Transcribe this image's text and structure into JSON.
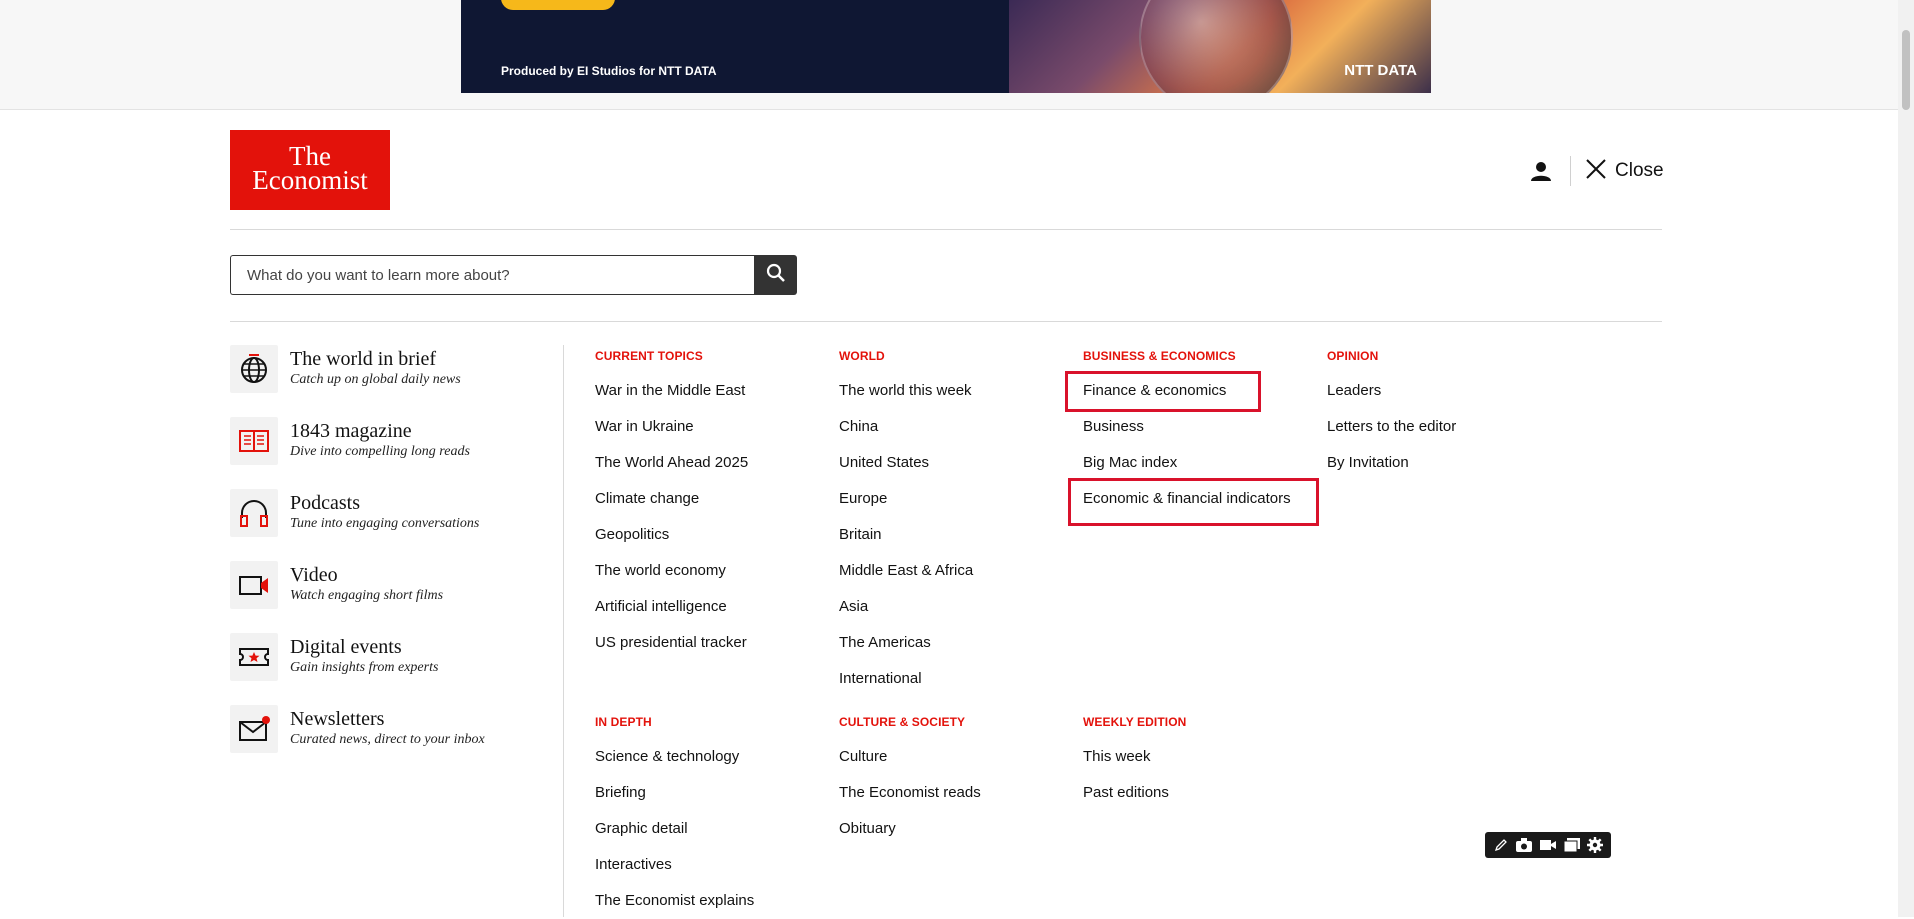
{
  "ad": {
    "credit": "Produced by EI Studios for NTT DATA",
    "brand": "NTT DATA"
  },
  "header": {
    "logo_line1": "The",
    "logo_line2": "Economist",
    "close_label": "Close"
  },
  "search": {
    "placeholder": "What do you want to learn more about?"
  },
  "products": [
    {
      "title": "The world in brief",
      "subtitle": "Catch up on global daily news",
      "icon": "globe-icon"
    },
    {
      "title": "1843 magazine",
      "subtitle": "Dive into compelling long reads",
      "icon": "magazine-icon"
    },
    {
      "title": "Podcasts",
      "subtitle": "Tune into engaging conversations",
      "icon": "headphones-icon"
    },
    {
      "title": "Video",
      "subtitle": "Watch engaging short films",
      "icon": "video-camera-icon"
    },
    {
      "title": "Digital events",
      "subtitle": "Gain insights from experts",
      "icon": "ticket-icon"
    },
    {
      "title": "Newsletters",
      "subtitle": "Curated news, direct to your inbox",
      "icon": "mail-icon"
    }
  ],
  "nav": {
    "current_topics": {
      "heading": "Current topics",
      "items": [
        "War in the Middle East",
        "War in Ukraine",
        "The World Ahead 2025",
        "Climate change",
        "Geopolitics",
        "The world economy",
        "Artificial intelligence",
        "US presidential tracker"
      ]
    },
    "world": {
      "heading": "World",
      "items": [
        "The world this week",
        "China",
        "United States",
        "Europe",
        "Britain",
        "Middle East & Africa",
        "Asia",
        "The Americas",
        "International"
      ]
    },
    "business": {
      "heading": "Business & economics",
      "items": [
        "Finance & economics",
        "Business",
        "Big Mac index",
        "Economic & financial indicators"
      ]
    },
    "opinion": {
      "heading": "Opinion",
      "items": [
        "Leaders",
        "Letters to the editor",
        "By Invitation"
      ]
    },
    "in_depth": {
      "heading": "In depth",
      "items": [
        "Science & technology",
        "Briefing",
        "Graphic detail",
        "Interactives",
        "The Economist explains"
      ]
    },
    "culture": {
      "heading": "Culture & society",
      "items": [
        "Culture",
        "The Economist reads",
        "Obituary"
      ]
    },
    "weekly": {
      "heading": "Weekly edition",
      "items": [
        "This week",
        "Past editions"
      ]
    }
  },
  "colors": {
    "brand_red": "#e3120b",
    "highlight": "#d9122b"
  }
}
